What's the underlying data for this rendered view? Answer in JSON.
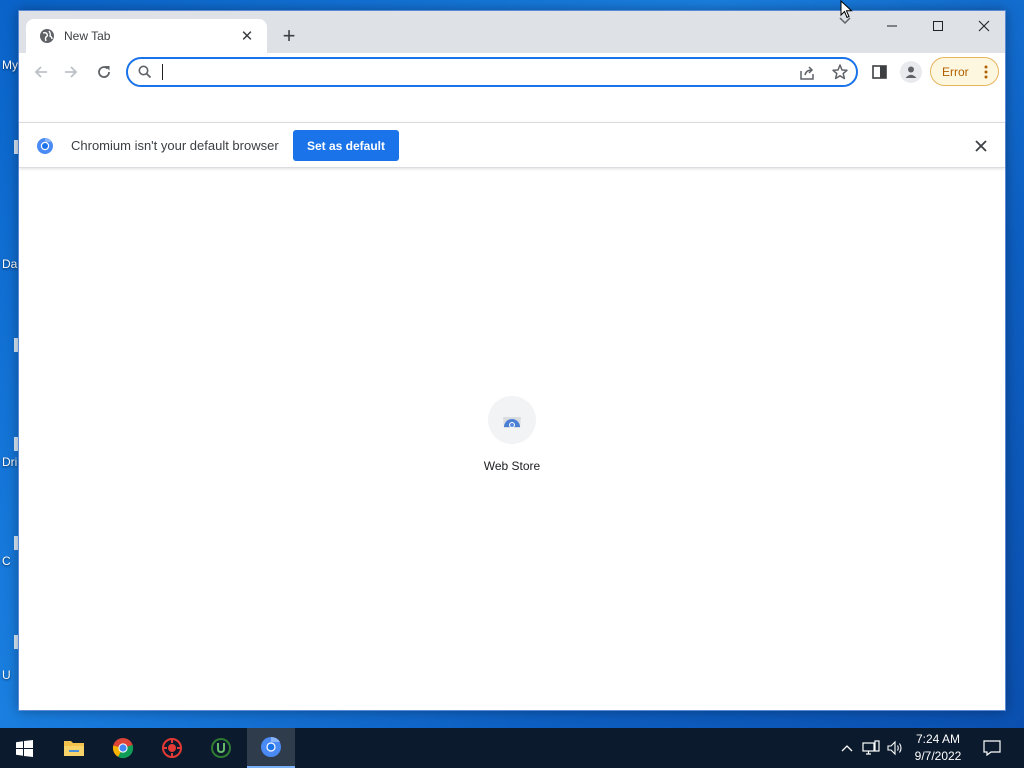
{
  "desktop": {
    "icon_labels": [
      "My",
      "Da",
      "Dri",
      "C",
      "U"
    ]
  },
  "browser": {
    "tab": {
      "title": "New Tab",
      "close_glyph": "✕",
      "icon": "globe-icon"
    },
    "new_tab_glyph": "+",
    "window_controls": {
      "minimize": "minimize-icon",
      "maximize": "maximize-icon",
      "close": "close-icon"
    },
    "toolbar": {
      "back": "back-arrow-icon",
      "forward": "forward-arrow-icon",
      "reload": "reload-icon",
      "address_value": "",
      "address_placeholder": "",
      "profile_error_label": "Error"
    },
    "infobar": {
      "message": "Chromium isn't your default browser",
      "button_label": "Set as default",
      "close_glyph": "✕"
    },
    "shortcuts": [
      {
        "label": "Web Store",
        "icon": "web-store-icon"
      }
    ]
  },
  "taskbar": {
    "apps": [
      "start-icon",
      "file-explorer-icon",
      "chrome-icon",
      "red-app-icon",
      "utorrent-icon",
      "chromium-icon"
    ],
    "clock_time": "7:24 AM",
    "clock_date": "9/7/2022"
  },
  "colors": {
    "accent": "#1a73e8",
    "error_chip_text": "#b06000",
    "taskbar": "#0b1a2d",
    "tabstrip": "#dee1e6"
  }
}
